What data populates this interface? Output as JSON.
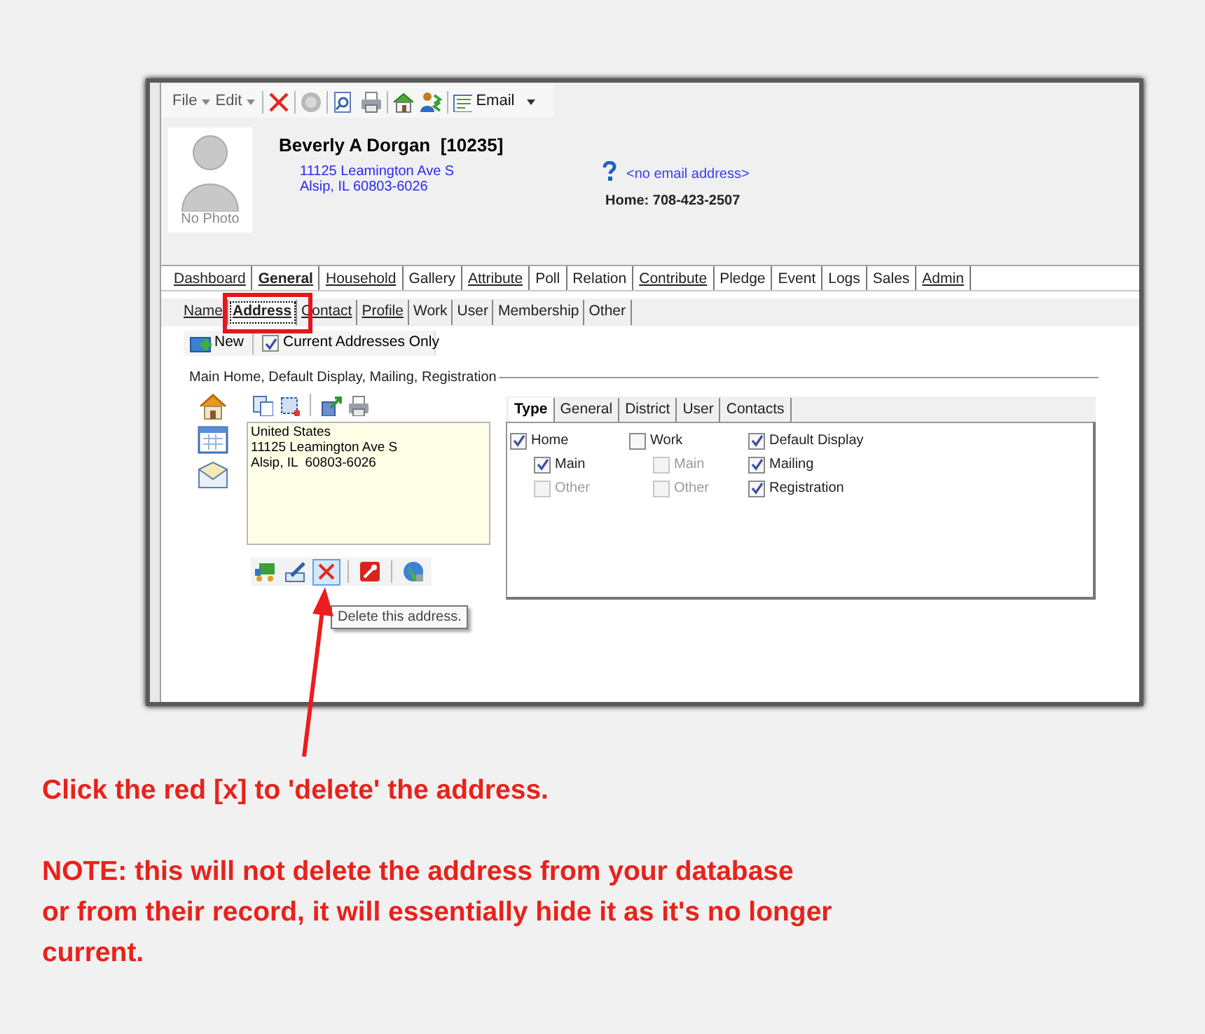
{
  "toolbar": {
    "menus": [
      {
        "label": "File"
      },
      {
        "label": "Edit"
      }
    ],
    "email_button": {
      "label": "Email"
    }
  },
  "header": {
    "name": "Beverly A Dorgan  [10235]",
    "photo_caption": "No Photo",
    "address_lines": [
      "11125 Leamington Ave S",
      "Alsip, IL 60803-6026"
    ],
    "email": "<no email address>",
    "phone": "Home: 708-423-2507"
  },
  "tabs": [
    {
      "label": "Dashboard",
      "selected": false,
      "underlined": true
    },
    {
      "label": "General",
      "selected": true,
      "underlined": true
    },
    {
      "label": "Household",
      "selected": false,
      "underlined": true
    },
    {
      "label": "Gallery",
      "selected": false,
      "underlined": false
    },
    {
      "label": "Attribute",
      "selected": false,
      "underlined": true
    },
    {
      "label": "Poll",
      "selected": false,
      "underlined": false
    },
    {
      "label": "Relation",
      "selected": false,
      "underlined": false
    },
    {
      "label": "Contribute",
      "selected": false,
      "underlined": true
    },
    {
      "label": "Pledge",
      "selected": false,
      "underlined": false
    },
    {
      "label": "Event",
      "selected": false,
      "underlined": false
    },
    {
      "label": "Logs",
      "selected": false,
      "underlined": false
    },
    {
      "label": "Sales",
      "selected": false,
      "underlined": false
    },
    {
      "label": "Admin",
      "selected": false,
      "underlined": true
    }
  ],
  "subtabs": [
    {
      "label": "Name",
      "selected": false,
      "underlined": true
    },
    {
      "label": "Address",
      "selected": true,
      "underlined": true
    },
    {
      "label": "Contact",
      "selected": false,
      "underlined": true
    },
    {
      "label": "Profile",
      "selected": false,
      "underlined": true
    },
    {
      "label": "Work",
      "selected": false,
      "underlined": false
    },
    {
      "label": "User",
      "selected": false,
      "underlined": false
    },
    {
      "label": "Membership",
      "selected": false,
      "underlined": false
    },
    {
      "label": "Other",
      "selected": false,
      "underlined": false
    }
  ],
  "address_toolbar": {
    "new_label": "New",
    "current_only": {
      "label": "Current Addresses Only",
      "checked": true
    }
  },
  "group_label": "Main Home, Default Display, Mailing, Registration",
  "address_text": [
    "United States",
    "11125 Leamington Ave S",
    "Alsip, IL  60803-6026"
  ],
  "actions": [
    {
      "kind": "truck",
      "highlighted": false
    },
    {
      "kind": "edit",
      "highlighted": false
    },
    {
      "kind": "delete",
      "highlighted": true
    },
    {
      "kind": "tool",
      "highlighted": false
    },
    {
      "kind": "globe",
      "highlighted": false
    }
  ],
  "detail_tabs": [
    {
      "label": "Type",
      "selected": true
    },
    {
      "label": "General",
      "selected": false
    },
    {
      "label": "District",
      "selected": false
    },
    {
      "label": "User",
      "selected": false
    },
    {
      "label": "Contacts",
      "selected": false
    }
  ],
  "type_options": [
    [
      {
        "label": "Home",
        "checked": true,
        "disabled": false,
        "children": [
          {
            "label": "Main",
            "checked": true,
            "disabled": false
          },
          {
            "label": "Other",
            "checked": false,
            "disabled": true
          }
        ]
      }
    ],
    [
      {
        "label": "Work",
        "checked": false,
        "disabled": false,
        "children": [
          {
            "label": "Main",
            "checked": false,
            "disabled": true
          },
          {
            "label": "Other",
            "checked": false,
            "disabled": true
          }
        ]
      }
    ],
    [
      {
        "label": "Default Display",
        "checked": true,
        "disabled": false
      },
      {
        "label": "Mailing",
        "checked": true,
        "disabled": false
      },
      {
        "label": "Registration",
        "checked": true,
        "disabled": false
      }
    ]
  ],
  "tooltip": "Delete this address.",
  "annotation": {
    "instruction": "Click the red [x] to 'delete' the address.",
    "note_lines": [
      "NOTE: this will not delete the address from your database",
      "or from their record, it will essentially hide it as it's no longer",
      "current."
    ]
  }
}
